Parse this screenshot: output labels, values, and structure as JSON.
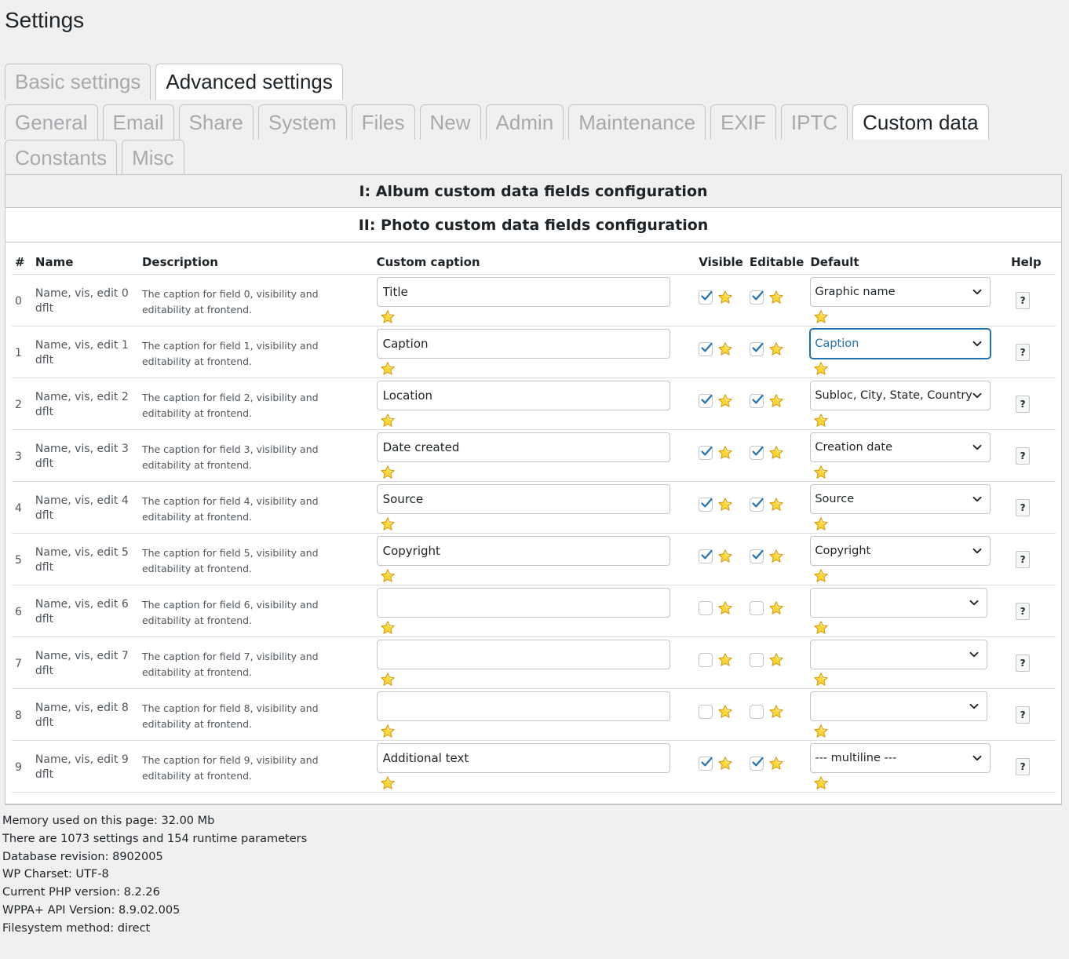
{
  "page": {
    "title": "Settings"
  },
  "primary_tabs": [
    {
      "label": "Basic settings",
      "active": false
    },
    {
      "label": "Advanced settings",
      "active": true
    }
  ],
  "secondary_tabs_row1": [
    {
      "label": "General",
      "active": false
    },
    {
      "label": "Email",
      "active": false
    },
    {
      "label": "Share",
      "active": false
    },
    {
      "label": "System",
      "active": false
    },
    {
      "label": "Files",
      "active": false
    },
    {
      "label": "New",
      "active": false
    },
    {
      "label": "Admin",
      "active": false
    },
    {
      "label": "Maintenance",
      "active": false
    },
    {
      "label": "EXIF",
      "active": false
    },
    {
      "label": "IPTC",
      "active": false
    },
    {
      "label": "Custom data",
      "active": true
    }
  ],
  "secondary_tabs_row2": [
    {
      "label": "Constants",
      "active": false
    },
    {
      "label": "Misc",
      "active": false
    }
  ],
  "sections": {
    "album": "I: Album custom data fields configuration",
    "photo": "II: Photo custom data fields configuration"
  },
  "table": {
    "headers": [
      "#",
      "Name",
      "Description",
      "Custom caption",
      "Visible",
      "Editable",
      "Default",
      "Help"
    ],
    "rows": [
      {
        "num": "0",
        "name": "Name, vis, edit 0 dflt",
        "desc": "The caption for field 0, visibility and editability at frontend.",
        "caption": "Title",
        "visible": true,
        "editable": true,
        "default": "Graphic name",
        "help": "?"
      },
      {
        "num": "1",
        "name": "Name, vis, edit 1 dflt",
        "desc": "The caption for field 1, visibility and editability at frontend.",
        "caption": "Caption",
        "visible": true,
        "editable": true,
        "default": "Caption",
        "help": "?",
        "focused": true
      },
      {
        "num": "2",
        "name": "Name, vis, edit 2 dflt",
        "desc": "The caption for field 2, visibility and editability at frontend.",
        "caption": "Location",
        "visible": true,
        "editable": true,
        "default": "Subloc, City, State, Country",
        "help": "?"
      },
      {
        "num": "3",
        "name": "Name, vis, edit 3 dflt",
        "desc": "The caption for field 3, visibility and editability at frontend.",
        "caption": "Date created",
        "visible": true,
        "editable": true,
        "default": "Creation date",
        "help": "?"
      },
      {
        "num": "4",
        "name": "Name, vis, edit 4 dflt",
        "desc": "The caption for field 4, visibility and editability at frontend.",
        "caption": "Source",
        "visible": true,
        "editable": true,
        "default": "Source",
        "help": "?"
      },
      {
        "num": "5",
        "name": "Name, vis, edit 5 dflt",
        "desc": "The caption for field 5, visibility and editability at frontend.",
        "caption": "Copyright",
        "visible": true,
        "editable": true,
        "default": "Copyright",
        "help": "?"
      },
      {
        "num": "6",
        "name": "Name, vis, edit 6 dflt",
        "desc": "The caption for field 6, visibility and editability at frontend.",
        "caption": "",
        "visible": false,
        "editable": false,
        "default": "",
        "help": "?"
      },
      {
        "num": "7",
        "name": "Name, vis, edit 7 dflt",
        "desc": "The caption for field 7, visibility and editability at frontend.",
        "caption": "",
        "visible": false,
        "editable": false,
        "default": "",
        "help": "?"
      },
      {
        "num": "8",
        "name": "Name, vis, edit 8 dflt",
        "desc": "The caption for field 8, visibility and editability at frontend.",
        "caption": "",
        "visible": false,
        "editable": false,
        "default": "",
        "help": "?"
      },
      {
        "num": "9",
        "name": "Name, vis, edit 9 dflt",
        "desc": "The caption for field 9, visibility and editability at frontend.",
        "caption": "Additional text",
        "visible": true,
        "editable": true,
        "default": "--- multiline ---",
        "help": "?"
      }
    ]
  },
  "footer": [
    "Memory used on this page: 32.00 Mb",
    "There are 1073 settings and 154 runtime parameters",
    "Database revision: 8902005",
    "WP Charset: UTF-8",
    "Current PHP version: 8.2.26",
    "WPPA+ API Version: 8.9.02.005",
    "Filesystem method: direct"
  ],
  "colors": {
    "accent": "#2271b1",
    "star": "#f5c518",
    "border": "#c3c4c7"
  },
  "icons": {
    "star": "star-icon",
    "check": "checkmark-icon",
    "chevron": "chevron-down-icon"
  }
}
